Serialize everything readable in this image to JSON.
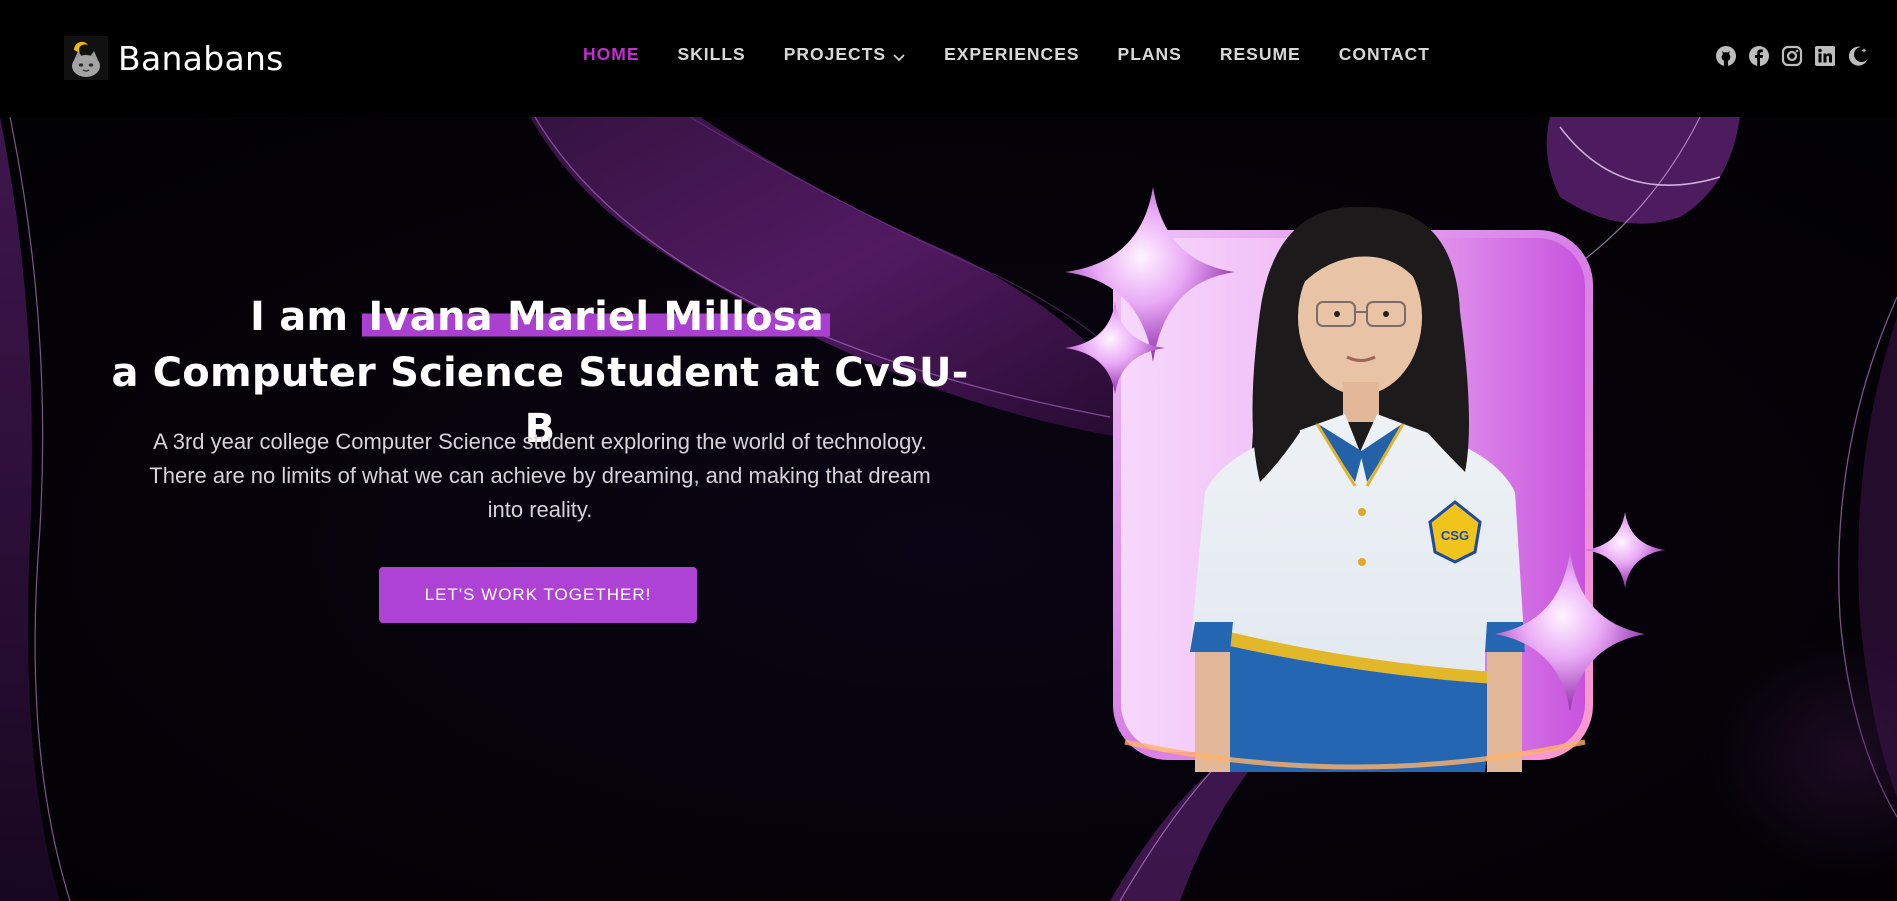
{
  "brand": {
    "name": "Banabans",
    "logo_icon": "cat-moon-icon"
  },
  "nav": {
    "items": [
      {
        "label": "HOME",
        "active": true
      },
      {
        "label": "SKILLS",
        "active": false
      },
      {
        "label": "PROJECTS",
        "active": false,
        "dropdown": true
      },
      {
        "label": "EXPERIENCES",
        "active": false
      },
      {
        "label": "PLANS",
        "active": false
      },
      {
        "label": "RESUME",
        "active": false
      },
      {
        "label": "CONTACT",
        "active": false
      }
    ],
    "active_color": "#c22ed0"
  },
  "social": [
    "github-icon",
    "facebook-icon",
    "instagram-icon",
    "linkedin-icon",
    "dark-mode-toggle-icon"
  ],
  "hero": {
    "intro": "I am",
    "name": "Ivana Mariel Millosa",
    "tagline": "a Computer Science Student at CvSU-B",
    "description": "A 3rd year college Computer Science student exploring the world of technology. There are no limits of what we can achieve by dreaming, and making that dream into reality.",
    "cta_label": "LET'S WORK TOGETHER!",
    "accent_color": "#ae42d4",
    "shirt_badge": "CSG"
  }
}
